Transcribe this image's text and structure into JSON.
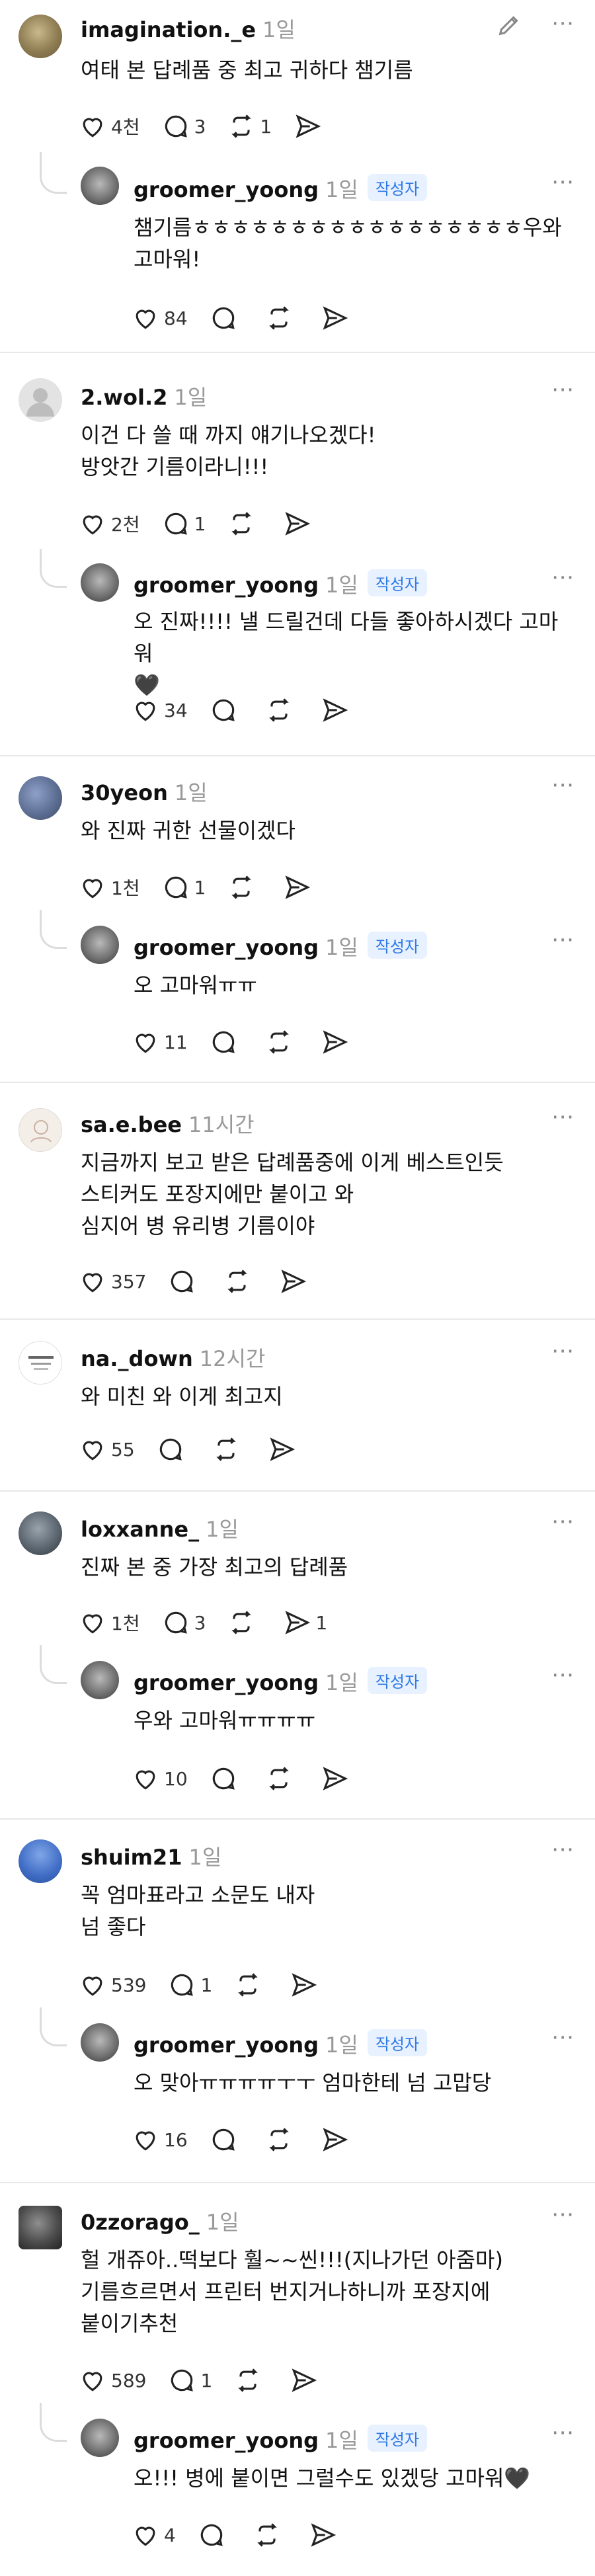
{
  "threads": [
    {
      "user": "imagination._e",
      "time": "1일",
      "text": "여태 본 답례품 중 최고 귀하다 챔기름",
      "likes": "4천",
      "comments": "3",
      "reposts": "1",
      "reply": {
        "user": "groomer_yoong",
        "time": "1일",
        "badge": "작성자",
        "text": "챔기름ㅎㅎㅎㅎㅎㅎㅎㅎㅎㅎㅎㅎㅎㅎㅎㅎㅎ우와\n고마워!",
        "likes": "84"
      }
    },
    {
      "user": "2.wol.2",
      "time": "1일",
      "text": "이건 다 쓸 때 까지 얘기나오겠다!\n방앗간 기름이라니!!!",
      "likes": "2천",
      "comments": "1",
      "reposts": "",
      "reply": {
        "user": "groomer_yoong",
        "time": "1일",
        "badge": "작성자",
        "text": "오 진짜!!!! 낼 드릴건데 다들 좋아하시겠다 고마워\n🖤",
        "likes": "34"
      }
    },
    {
      "user": "30yeon",
      "time": "1일",
      "text": "와 진짜 귀한 선물이겠다",
      "likes": "1천",
      "comments": "1",
      "reposts": "",
      "reply": {
        "user": "groomer_yoong",
        "time": "1일",
        "badge": "작성자",
        "text": "오 고마워ㅠㅠ",
        "likes": "11"
      }
    },
    {
      "user": "sa.e.bee",
      "time": "11시간",
      "text": "지금까지 보고 받은 답례품중에 이게 베스트인듯\n스티커도 포장지에만 붙이고 와\n심지어 병 유리병 기름이야",
      "likes": "357",
      "comments": "",
      "reposts": ""
    },
    {
      "user": "na._down",
      "time": "12시간",
      "text": "와 미친 와 이게 최고지",
      "likes": "55",
      "comments": "",
      "reposts": ""
    },
    {
      "user": "loxxanne_",
      "time": "1일",
      "text": "진짜 본 중 가장 최고의 답례품",
      "likes": "1천",
      "comments": "3",
      "reposts": "",
      "shares": "1",
      "reply": {
        "user": "groomer_yoong",
        "time": "1일",
        "badge": "작성자",
        "text": "우와 고마워ㅠㅠㅠㅠ",
        "likes": "10"
      }
    },
    {
      "user": "shuim21",
      "time": "1일",
      "text": "꼭 엄마표라고 소문도 내자\n넘 좋다",
      "likes": "539",
      "comments": "1",
      "reposts": "",
      "reply": {
        "user": "groomer_yoong",
        "time": "1일",
        "badge": "작성자",
        "text": "오 맞아ㅠㅠㅠㅠㅜㅜ 엄마한테 넘 고맙당",
        "likes": "16"
      }
    },
    {
      "user": "0zzorago_",
      "time": "1일",
      "text": "헐 개쥬아..떡보다 훨~~씬!!!(지나가던 아줌마)\n기름흐르면서 프린터 번지거나하니까 포장지에\n붙이기추천",
      "likes": "589",
      "comments": "1",
      "reposts": "",
      "reply": {
        "user": "groomer_yoong",
        "time": "1일",
        "badge": "작성자",
        "text": "오!!! 병에 붙이면 그럴수도 있겠당 고마워🖤",
        "likes": "4"
      }
    }
  ],
  "icons": {
    "like": "heart-icon",
    "comment": "comment-icon",
    "repost": "repost-icon",
    "share": "share-icon",
    "more": "more-icon",
    "edit": "pencil-icon"
  },
  "colors": {
    "badge_bg": "#e8f1ff",
    "badge_text": "#2f7ae5",
    "time": "#999999",
    "divider": "#e8e8e8"
  }
}
